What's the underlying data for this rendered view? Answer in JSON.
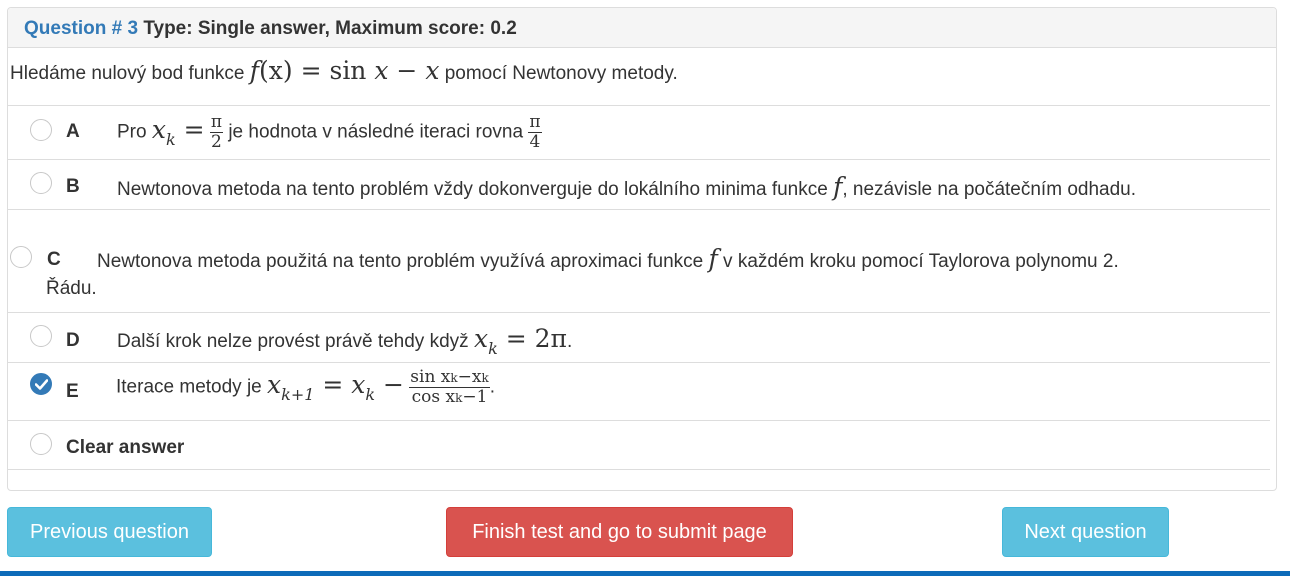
{
  "question": {
    "number_label": "Question # 3",
    "type_label": "Type: Single answer, Maximum score: 0.2",
    "text_before": "Hledáme nulový bod funkce",
    "formula_f": "f",
    "formula_args": "(x) = ",
    "formula_sin": "sin",
    "formula_rest": "x − x",
    "text_after": "pomocí Newtonovy metody."
  },
  "options": [
    {
      "letter": "A",
      "text_pre": "Pro",
      "math_x": "x",
      "math_k": "k",
      "math_eq": "=",
      "frac1_num": "π",
      "frac1_den": "2",
      "text_mid": "je hodnota v následné iteraci rovna",
      "frac2_num": "π",
      "frac2_den": "4",
      "selected": false
    },
    {
      "letter": "B",
      "text_pre": "Newtonova metoda na tento problém vždy dokonverguje do lokálního minima funkce",
      "math_f": "f",
      "text_post": ", nezávisle na počátečním odhadu.",
      "selected": false
    },
    {
      "letter": "C",
      "text_pre": "Newtonova metoda použitá na tento problém využívá aproximaci funkce",
      "math_f": "f",
      "text_post": "v každém kroku pomocí Taylorova polynomu 2.",
      "text_line2": "Řádu.",
      "selected": false
    },
    {
      "letter": "D",
      "text_pre": "Další krok nelze provést právě tehdy když",
      "math_x": "x",
      "math_k": "k",
      "math_rhs": "= 2π",
      "text_post": ".",
      "selected": false
    },
    {
      "letter": "E",
      "text_pre": "Iterace metody je",
      "math_lhs_x": "x",
      "math_lhs_sub": "k+1",
      "math_eq": "=",
      "math_rhs_x": "x",
      "math_rhs_sub": "k",
      "math_minus": "−",
      "frac_num": "sin x",
      "frac_num_sub": "k",
      "frac_num_rest": "−x",
      "frac_num_sub2": "k",
      "frac_den": "cos x",
      "frac_den_sub": "k",
      "frac_den_rest": "−1",
      "text_post": ".",
      "selected": true
    }
  ],
  "clear_answer": "Clear answer",
  "buttons": {
    "previous": "Previous question",
    "finish": "Finish test and go to submit page",
    "next": "Next question"
  },
  "colors": {
    "link_blue": "#337ab7",
    "info": "#5bc0de",
    "danger": "#d9534f",
    "bottom_bar": "#0d6bb9"
  }
}
